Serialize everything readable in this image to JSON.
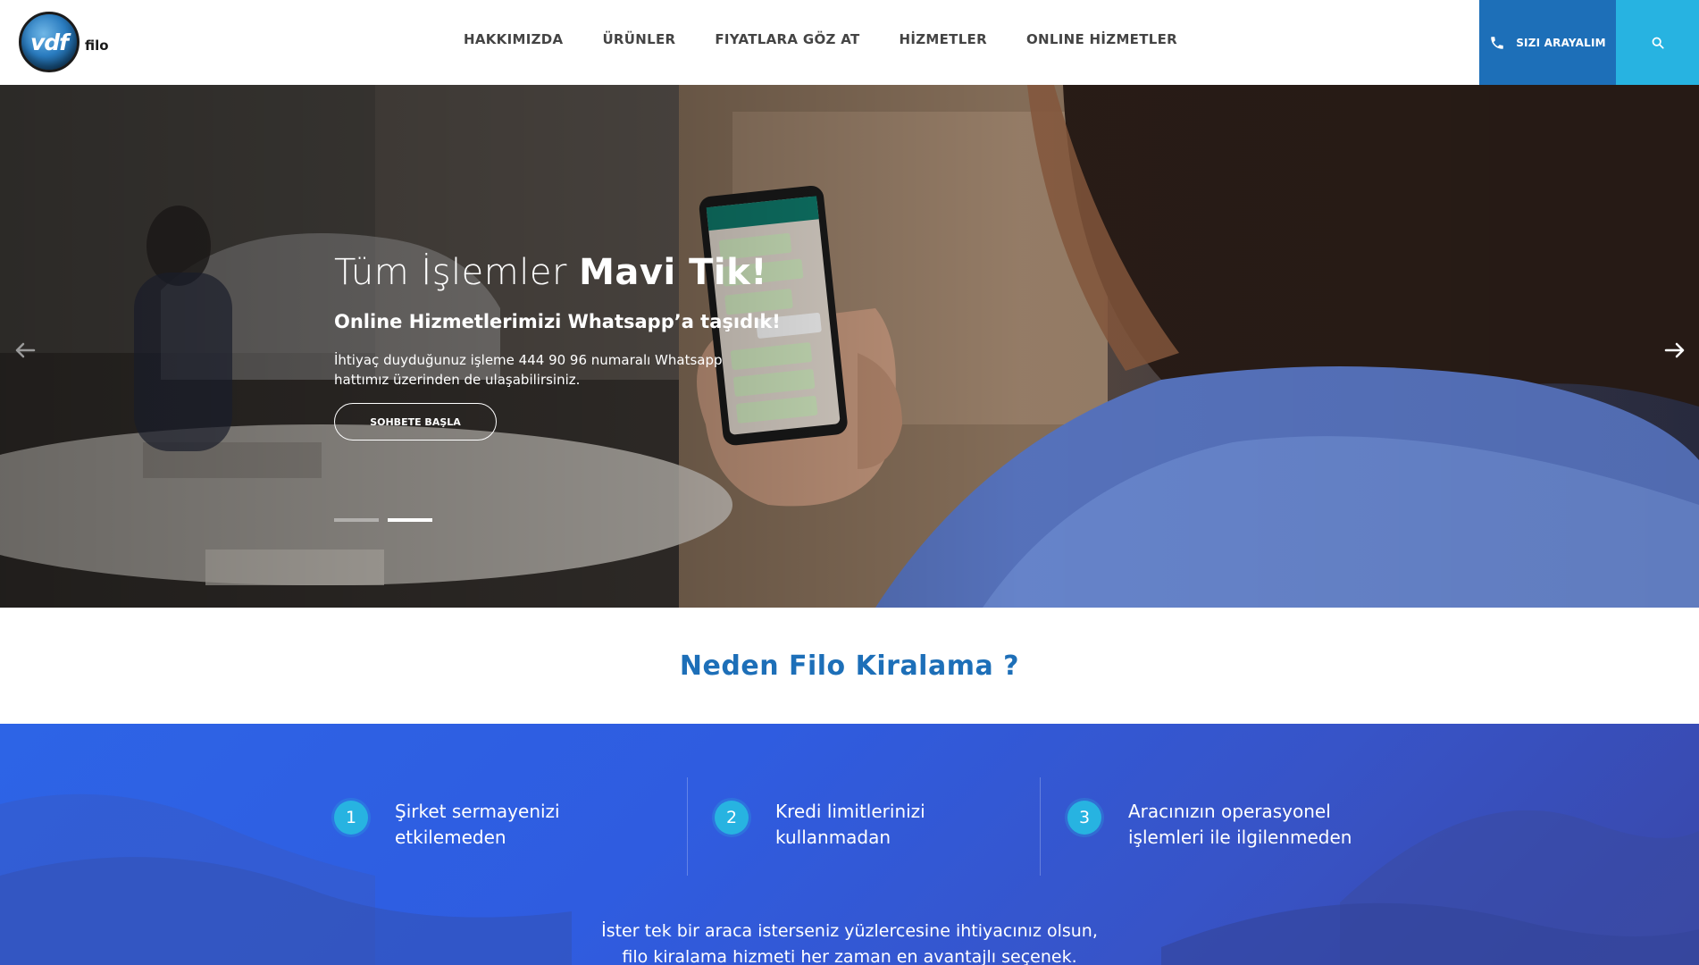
{
  "header": {
    "logo_mark": "vdf",
    "logo_word": "filo",
    "nav": [
      "HAKKIMIZDA",
      "ÜRÜNLER",
      "FIYATLARA GÖZ AT",
      "HİZMETLER",
      "ONLINE HİZMETLER"
    ],
    "call_label": "SIZI ARAYALIM",
    "call_icon": "phone-icon",
    "search_icon": "search-icon",
    "colors": {
      "call_bg": "#1d6fb8",
      "search_bg": "#27b3e1"
    }
  },
  "hero": {
    "title_light": "Tüm İşlemler ",
    "title_bold": "Mavi Tik!",
    "subtitle": "Online Hizmetlerimizi Whatsapp’a taşıdık!",
    "description": "İhtiyaç duyduğunuz işleme 444 90 96 numaralı Whatsapp hattımız üzerinden de ulaşabilirsiniz.",
    "cta": "SOHBETE BAŞLA",
    "slide_count": 2,
    "active_slide": 2,
    "prev_icon": "arrow-left-icon",
    "next_icon": "arrow-right-icon"
  },
  "why": {
    "title": "Neden Filo Kiralama ?"
  },
  "features": [
    {
      "num": "1",
      "text": "Şirket sermayenizi etkilemeden"
    },
    {
      "num": "2",
      "text": "Kredi limitlerinizi kullanmadan"
    },
    {
      "num": "3",
      "text": "Aracınızın operasyonel işlemleri ile ilgilenmeden"
    }
  ],
  "band": {
    "line1": "İster tek bir araca isterseniz yüzlercesine ihtiyacınız olsun,",
    "line2": "filo kiralama hizmeti her zaman en avantajlı seçenek.",
    "accent": "#2d64e6"
  }
}
